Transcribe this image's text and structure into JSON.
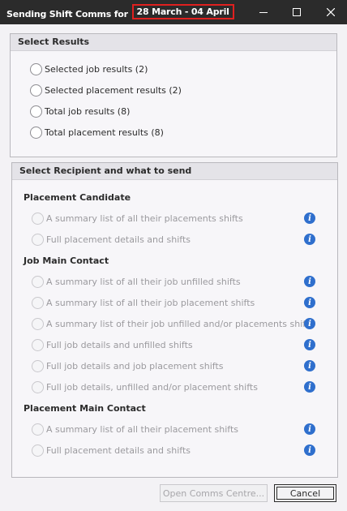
{
  "window": {
    "title_prefix": "Sending Shift Comms for",
    "title_date_range": "28 March - 04 April",
    "highlight_color": "#e0201f",
    "controls": [
      "minimize-icon",
      "maximize-icon",
      "close-icon"
    ]
  },
  "select_results": {
    "header": "Select Results",
    "options": [
      {
        "label": "Selected job results (2)"
      },
      {
        "label": "Selected placement results (2)"
      },
      {
        "label": "Total job results (8)"
      },
      {
        "label": "Total placement results (8)"
      }
    ]
  },
  "recipient": {
    "header": "Select Recipient and what to send",
    "sections": [
      {
        "title": "Placement Candidate",
        "options": [
          "A summary list of all their placements shifts",
          "Full placement details and shifts"
        ]
      },
      {
        "title": "Job Main Contact",
        "options": [
          "A summary list of all their job unfilled shifts",
          "A summary list of all their job placement shifts",
          "A summary list of their job unfilled and/or placements shifts",
          "Full job details and unfilled shifts",
          "Full job details and job placement shifts",
          "Full job details, unfilled and/or placement shifts"
        ]
      },
      {
        "title": "Placement Main Contact",
        "options": [
          "A summary list of all their placement shifts",
          "Full placement details and shifts"
        ]
      }
    ],
    "info_icon": "info-icon"
  },
  "footer": {
    "open_comms_label": "Open Comms Centre...",
    "cancel_label": "Cancel"
  }
}
